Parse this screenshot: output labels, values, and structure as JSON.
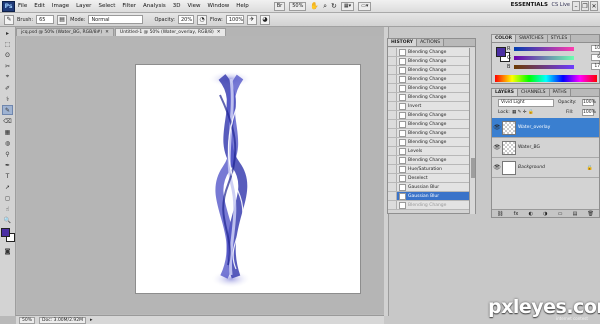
{
  "app": {
    "logo": "Ps",
    "essentials": "ESSENTIALS",
    "cs_live": "CS Live",
    "window_controls": [
      "–",
      "❐",
      "✕"
    ]
  },
  "menubar": {
    "items": [
      "File",
      "Edit",
      "Image",
      "Layer",
      "Select",
      "Filter",
      "Analysis",
      "3D",
      "View",
      "Window",
      "Help"
    ],
    "zoom": "50%"
  },
  "options": {
    "brush_label": "Brush:",
    "brush_size": "65",
    "mode_label": "Mode:",
    "mode_value": "Normal",
    "opacity_label": "Opacity:",
    "opacity_value": "20%",
    "flow_label": "Flow:",
    "flow_value": "100%"
  },
  "tabs": [
    {
      "label": "jcq.psd @ 50% (Water_BG, RGB/8#)",
      "close": "✕"
    },
    {
      "label": "Untitled-1 @ 50% (Water_overlay, RGB/8)",
      "close": "✕"
    }
  ],
  "tools": [
    "▸",
    "⬚",
    "ʘ",
    "✂",
    "⌖",
    "✐",
    "⚕",
    "✎",
    "⌫",
    "▦",
    "◍",
    "⚲",
    "✒",
    "T",
    "➚",
    "◻",
    "☝",
    "🔍"
  ],
  "status": {
    "zoom": "50%",
    "doc": "Doc: 3.00M/2.92M"
  },
  "history": {
    "tabs": [
      "HISTORY",
      "ACTIONS"
    ],
    "rows": [
      {
        "label": "Blending Change",
        "state": "normal"
      },
      {
        "label": "Blending Change",
        "state": "normal"
      },
      {
        "label": "Blending Change",
        "state": "normal"
      },
      {
        "label": "Blending Change",
        "state": "normal"
      },
      {
        "label": "Blending Change",
        "state": "normal"
      },
      {
        "label": "Blending Change",
        "state": "normal"
      },
      {
        "label": "Invert",
        "state": "normal"
      },
      {
        "label": "Blending Change",
        "state": "normal"
      },
      {
        "label": "Blending Change",
        "state": "normal"
      },
      {
        "label": "Blending Change",
        "state": "normal"
      },
      {
        "label": "Blending Change",
        "state": "normal"
      },
      {
        "label": "Levels",
        "state": "normal"
      },
      {
        "label": "Blending Change",
        "state": "normal"
      },
      {
        "label": "Hue/Saturation",
        "state": "normal"
      },
      {
        "label": "Deselect",
        "state": "normal"
      },
      {
        "label": "Gaussian Blur",
        "state": "normal"
      },
      {
        "label": "Gaussian Blur",
        "state": "selected"
      },
      {
        "label": "Blending Change",
        "state": "greyed"
      }
    ]
  },
  "color_panel": {
    "tabs": [
      "COLOR",
      "SWATCHES",
      "STYLES"
    ],
    "channels": [
      {
        "label": "R",
        "value": "108"
      },
      {
        "label": "G",
        "value": "60"
      },
      {
        "label": "B",
        "value": "175"
      }
    ]
  },
  "layers_panel": {
    "tabs": [
      "LAYERS",
      "CHANNELS",
      "PATHS"
    ],
    "blend_mode": "Vivid Light",
    "opacity_label": "Opacity:",
    "opacity": "100%",
    "lock_label": "Lock:",
    "fill_label": "Fill:",
    "fill": "100%",
    "layers": [
      {
        "name": "Water_overlay",
        "selected": true,
        "checker": true
      },
      {
        "name": "Water_BG",
        "selected": false,
        "checker": true
      },
      {
        "name": "Background",
        "selected": false,
        "checker": false
      }
    ],
    "footer_icons": [
      "⛓",
      "fx",
      "◐",
      "◑",
      "▭",
      "▤",
      "🗑"
    ]
  },
  "watermark": {
    "text": "pxleyes.com",
    "sub": "internet contest"
  },
  "colors": {
    "foreground": "#4a2ea3",
    "selection": "#3a73c9"
  }
}
